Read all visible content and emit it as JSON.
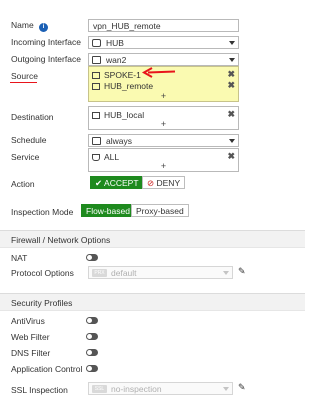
{
  "form": {
    "name_label": "Name",
    "name_value": "vpn_HUB_remote",
    "incoming_label": "Incoming Interface",
    "incoming_value": "HUB",
    "outgoing_label": "Outgoing Interface",
    "outgoing_value": "wan2",
    "source_label": "Source",
    "source_items": [
      "SPOKE-1",
      "HUB_remote"
    ],
    "destination_label": "Destination",
    "destination_items": [
      "HUB_local"
    ],
    "schedule_label": "Schedule",
    "schedule_value": "always",
    "service_label": "Service",
    "service_items": [
      "ALL"
    ],
    "action_label": "Action",
    "accept_label": "ACCEPT",
    "deny_label": "DENY",
    "inspection_label": "Inspection Mode",
    "flow_label": "Flow-based",
    "proxy_label": "Proxy-based",
    "plus": "+"
  },
  "firewall_section": {
    "title": "Firewall / Network Options",
    "nat_label": "NAT",
    "protocol_label": "Protocol Options",
    "protocol_badge": "PRX",
    "protocol_value": "default"
  },
  "security_section": {
    "title": "Security Profiles",
    "antivirus_label": "AntiVirus",
    "webfilter_label": "Web Filter",
    "dnsfilter_label": "DNS Filter",
    "appcontrol_label": "Application Control",
    "ssl_label": "SSL Inspection",
    "ssl_badge": "SSL",
    "ssl_value": "no-inspection"
  },
  "colors": {
    "accept_green": "#1e8a1e",
    "deny_red": "#cc2222",
    "source_highlight": "#fafab1",
    "annotation_red": "#e8141b",
    "info_blue": "#1a5fb4"
  }
}
